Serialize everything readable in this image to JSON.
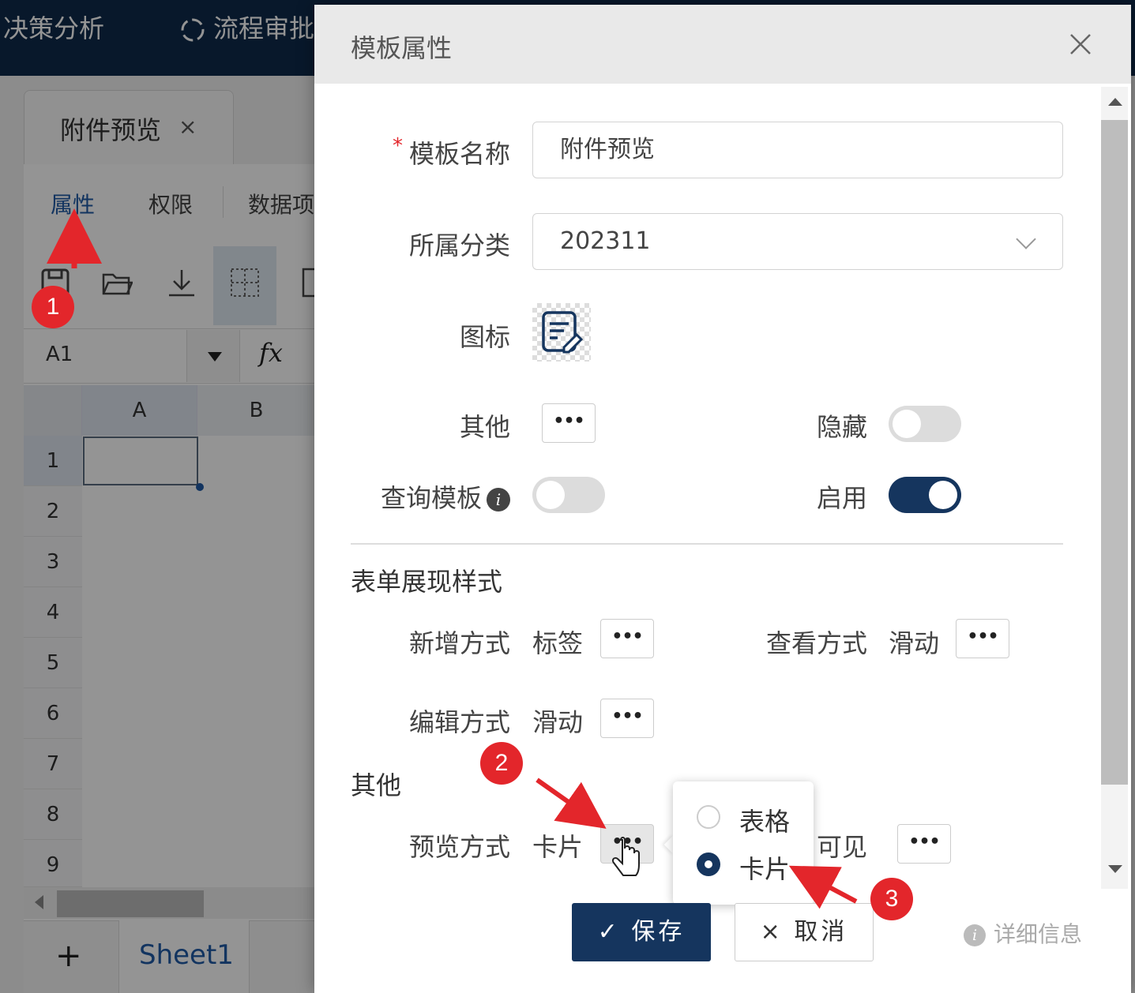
{
  "topnav": {
    "item1": "决策分析",
    "item2": "流程审批"
  },
  "doc_tab": {
    "label": "附件预览",
    "close": "×"
  },
  "sub_tabs": [
    "属性",
    "权限",
    "数据项"
  ],
  "formula_bar": {
    "cell_ref": "A1",
    "fx": "fx"
  },
  "columns": [
    "A",
    "B"
  ],
  "rows": [
    "1",
    "2",
    "3",
    "4",
    "5",
    "6",
    "7",
    "8",
    "9"
  ],
  "sheet_bar": {
    "add": "+",
    "sheet": "Sheet1"
  },
  "annotations": [
    "1",
    "2",
    "3"
  ],
  "dialog": {
    "title": "模板属性",
    "required_mark": "*",
    "name_label": "模板名称",
    "name_value": "附件预览",
    "category_label": "所属分类",
    "category_value": "202311",
    "icon_label": "图标",
    "other_label": "其他",
    "hidden_label": "隐藏",
    "hidden_on": false,
    "query_label": "查询模板",
    "query_on": false,
    "enabled_label": "启用",
    "enabled_on": true,
    "dots": "•••",
    "section_display": "表单展现样式",
    "add_mode_label": "新增方式",
    "add_mode_value": "标签",
    "view_mode_label": "查看方式",
    "view_mode_value": "滑动",
    "edit_mode_label": "编辑方式",
    "edit_mode_value": "滑动",
    "section_other": "其他",
    "preview_label": "预览方式",
    "preview_value": "卡片",
    "visible_label": "可见",
    "preview_options": [
      {
        "label": "表格",
        "checked": false
      },
      {
        "label": "卡片",
        "checked": true
      }
    ],
    "save": "✓ 保存",
    "cancel": "× 取消",
    "detail": "详细信息"
  },
  "colors": {
    "nav": "#0e2a4a",
    "primary": "#15355e",
    "badge": "#e3262b"
  }
}
